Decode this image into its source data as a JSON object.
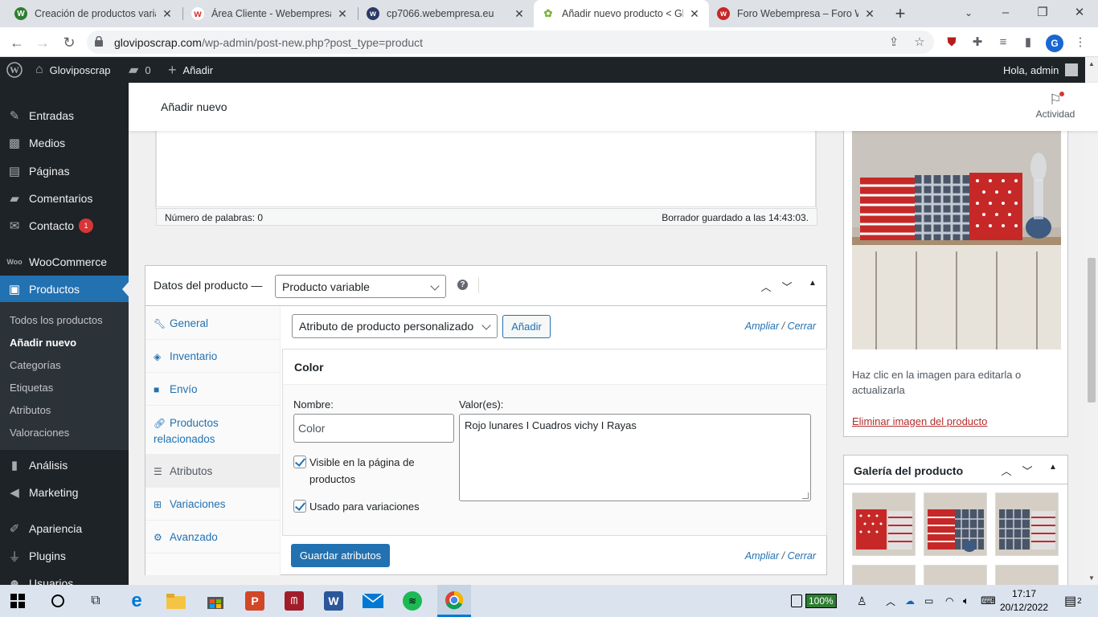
{
  "browser": {
    "tabs": [
      {
        "title": "Creación de productos variab",
        "favicon_color": "#2e7d32",
        "favicon_letter": "W"
      },
      {
        "title": "Área Cliente - Webempresa E",
        "favicon_color": "#d32f2f",
        "favicon_letter": "W"
      },
      {
        "title": "cp7066.webempresa.eu",
        "favicon_color": "#2b3a67",
        "favicon_letter": "W"
      },
      {
        "title": "Añadir nuevo producto < Gl",
        "favicon_color": "#7cb342",
        "favicon_letter": "G"
      },
      {
        "title": "Foro Webempresa – Foro Wo",
        "favicon_color": "#c62828",
        "favicon_letter": "W"
      }
    ],
    "url_host": "gloviposcrap.com",
    "url_path": "/wp-admin/post-new.php?post_type=product",
    "profile_letter": "G"
  },
  "adminbar": {
    "site_name": "Gloviposcrap",
    "comments_count": "0",
    "new_label": "Añadir",
    "greeting": "Hola, admin"
  },
  "sidebar": {
    "items": [
      {
        "label": "Entradas",
        "icon": "pin-icon"
      },
      {
        "label": "Medios",
        "icon": "media-icon"
      },
      {
        "label": "Páginas",
        "icon": "page-icon"
      },
      {
        "label": "Comentarios",
        "icon": "comment-icon"
      },
      {
        "label": "Contacto",
        "icon": "mail-icon",
        "badge": "1"
      },
      {
        "label": "WooCommerce",
        "icon": "woo-icon"
      },
      {
        "label": "Productos",
        "icon": "product-icon"
      },
      {
        "label": "Análisis",
        "icon": "chart-icon"
      },
      {
        "label": "Marketing",
        "icon": "megaphone-icon"
      },
      {
        "label": "Apariencia",
        "icon": "brush-icon"
      },
      {
        "label": "Plugins",
        "icon": "plugin-icon"
      },
      {
        "label": "Usuarios",
        "icon": "user-icon"
      }
    ],
    "submenu": [
      "Todos los productos",
      "Añadir nuevo",
      "Categorías",
      "Etiquetas",
      "Atributos",
      "Valoraciones"
    ]
  },
  "wc_header": {
    "title": "Añadir nuevo",
    "activity_label": "Actividad"
  },
  "editor": {
    "word_count": "Número de palabras: 0",
    "draft_saved": "Borrador guardado a las 14:43:03."
  },
  "product_data": {
    "title": "Datos del producto —",
    "type_value": "Producto variable",
    "tabs": [
      "General",
      "Inventario",
      "Envío",
      "Productos relacionados",
      "Atributos",
      "Variaciones",
      "Avanzado"
    ],
    "active_tab": "Atributos",
    "attr_select_value": "Atributo de producto personalizado",
    "add_button": "Añadir",
    "expand_label": "Ampliar",
    "close_label": "Cerrar",
    "attribute": {
      "heading": "Color",
      "name_label": "Nombre:",
      "name_value": "Color",
      "values_label": "Valor(es):",
      "values_value": "Rojo lunares I Cuadros vichy I Rayas",
      "visible_label": "Visible en la página de productos",
      "visible_checked": true,
      "variations_label": "Usado para variaciones",
      "variations_checked": true
    },
    "save_button": "Guardar atributos"
  },
  "product_image": {
    "help_text": "Haz clic en la imagen para editarla o actualizarla",
    "remove_link": "Eliminar imagen del producto"
  },
  "gallery": {
    "title": "Galería del producto"
  },
  "taskbar": {
    "battery": "100%",
    "time": "17:17",
    "date": "20/12/2022",
    "notification_count": "2"
  }
}
